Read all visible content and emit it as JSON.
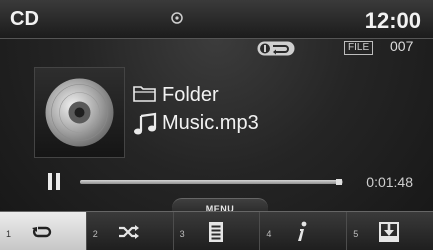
{
  "header": {
    "mode": "CD",
    "clock": "12:00",
    "disc_indicator_icon": "disc-icon"
  },
  "status": {
    "repeat_icon": "repeat-folder-icon",
    "file_label": "FILE",
    "file_number": "007"
  },
  "now_playing": {
    "album_art_icon": "cd-disc-icon",
    "folder_icon": "folder-icon",
    "folder": "Folder",
    "track_icon": "music-note-icon",
    "track": "Music.mp3"
  },
  "playback": {
    "state_icon": "pause-icon",
    "progress_fraction": 0.985,
    "elapsed": "0:01:48"
  },
  "menu": {
    "label": "MENU"
  },
  "softkeys": [
    {
      "number": "1",
      "icon": "repeat-icon",
      "active": true
    },
    {
      "number": "2",
      "icon": "shuffle-icon",
      "active": false
    },
    {
      "number": "3",
      "icon": "list-icon",
      "active": false
    },
    {
      "number": "4",
      "icon": "info-icon",
      "active": false
    },
    {
      "number": "5",
      "icon": "save-icon",
      "active": false
    }
  ],
  "colors": {
    "background": "#1c1c1c",
    "text": "#f2f2f2",
    "active_key": "#dcdcdc"
  }
}
